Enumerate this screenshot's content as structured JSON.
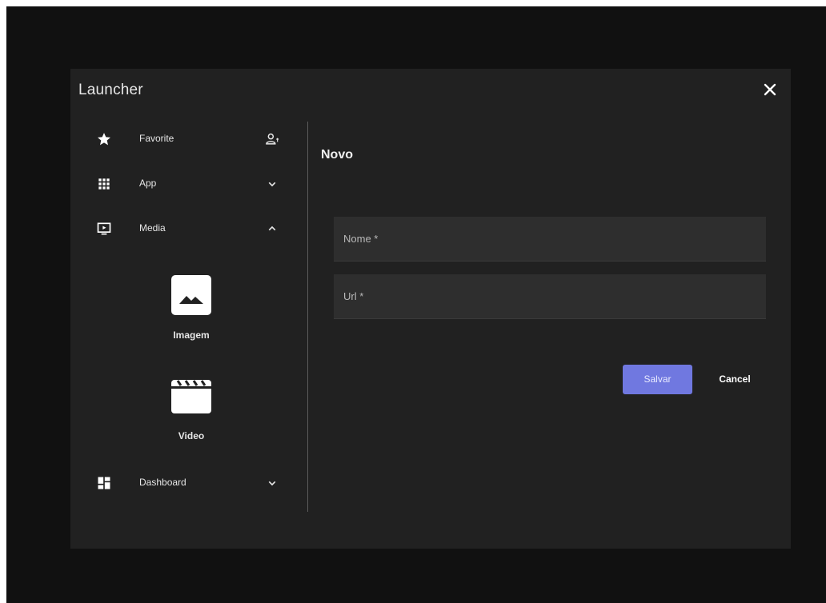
{
  "dialog": {
    "title": "Launcher"
  },
  "sidebar": {
    "items": [
      {
        "label": "Favorite",
        "icon": "star-icon",
        "trailing_icon": "person-add-icon"
      },
      {
        "label": "App",
        "icon": "apps-grid-icon",
        "trailing_icon": "chevron-down-icon"
      },
      {
        "label": "Media",
        "icon": "tv-play-icon",
        "trailing_icon": "chevron-up-icon"
      },
      {
        "label": "Dashboard",
        "icon": "dashboard-icon",
        "trailing_icon": "chevron-down-icon"
      }
    ],
    "media_tiles": [
      {
        "label": "Imagem",
        "icon": "image-icon"
      },
      {
        "label": "Video",
        "icon": "clapperboard-icon"
      }
    ]
  },
  "form": {
    "title": "Novo",
    "name_field": {
      "placeholder": "Nome *",
      "value": ""
    },
    "url_field": {
      "placeholder": "Url *",
      "value": ""
    },
    "save_label": "Salvar",
    "cancel_label": "Cancel"
  },
  "colors": {
    "background": "#111111",
    "dialog": "#212121",
    "field": "#2e2e2e",
    "accent": "#7078e0"
  }
}
